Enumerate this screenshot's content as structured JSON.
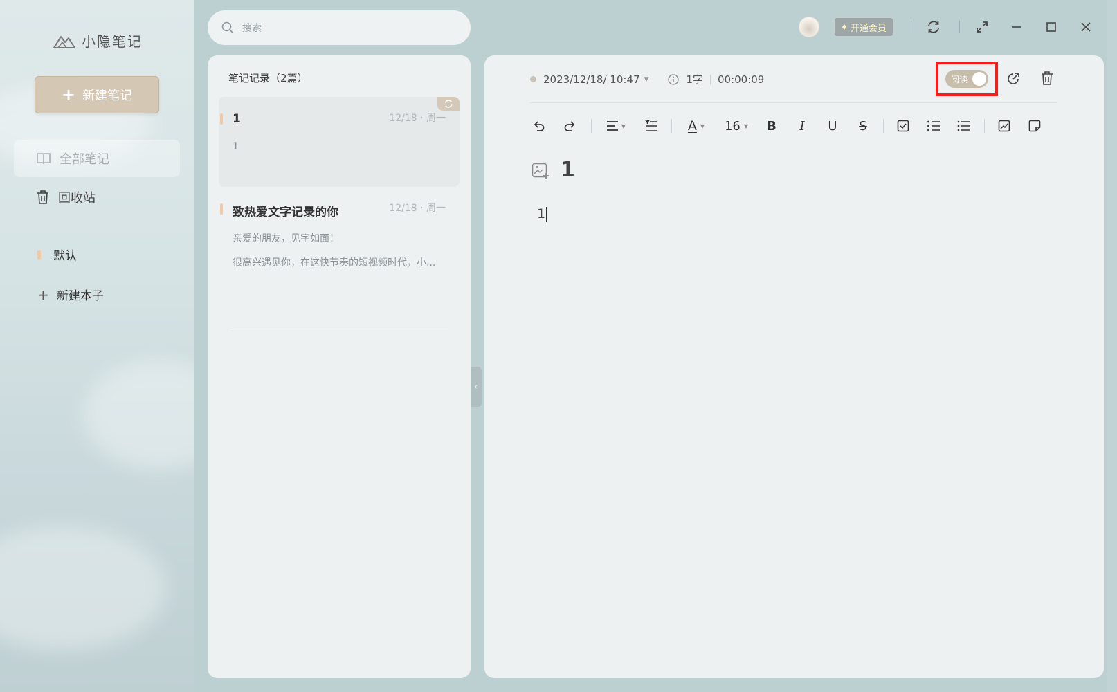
{
  "app": {
    "name": "小隐笔记"
  },
  "sidebar": {
    "new_note_label": "新建笔记",
    "nav": [
      {
        "label": "全部笔记",
        "active": true
      },
      {
        "label": "回收站",
        "active": false
      }
    ],
    "notebooks": [
      {
        "label": "默认"
      }
    ],
    "new_notebook_label": "新建本子"
  },
  "search": {
    "placeholder": "搜索"
  },
  "topbar": {
    "vip_label": "开通会员"
  },
  "list": {
    "title": "笔记记录（2篇）",
    "notes": [
      {
        "title": "1",
        "date": "12/18 · 周一",
        "preview": [
          "1"
        ]
      },
      {
        "title": "致热爱文字记录的你",
        "date": "12/18 · 周一",
        "preview": [
          "亲爱的朋友，见字如面！",
          "很高兴遇见你，在这快节奏的短视频时代，小..."
        ]
      }
    ]
  },
  "editor": {
    "datetime": "2023/12/18/ 10:47",
    "word_count": "1字",
    "duration": "00:00:09",
    "read_label": "阅读",
    "font_size": "16",
    "doc_title": "1",
    "doc_body": "1"
  },
  "colors": {
    "accent": "#d4c7b3",
    "highlight": "#ff1a1a",
    "notebook_mark": "#f0c9a8"
  }
}
